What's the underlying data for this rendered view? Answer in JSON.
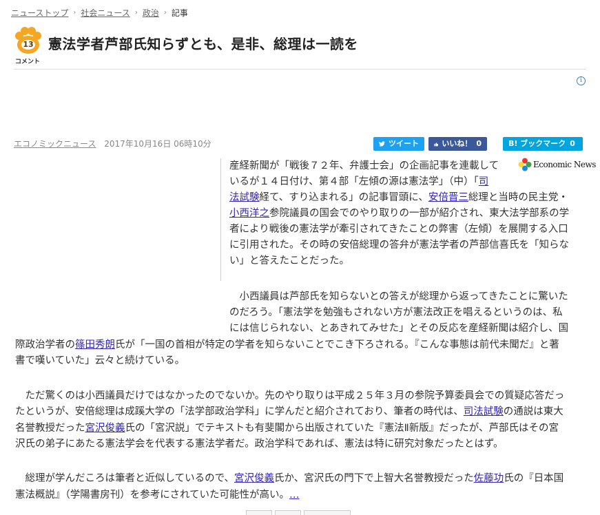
{
  "breadcrumb": {
    "items": [
      "ニューストップ",
      "社会ニュース",
      "政治"
    ],
    "current": "記事"
  },
  "article": {
    "comment_count": "13",
    "comment_label": "コメント",
    "title": "憲法学者芦部氏知らずとも、是非、総理は一読を",
    "source": "エコノミックニュース",
    "datetime": "2017年10月16日 06時10分",
    "publisher_logo": "Economic News"
  },
  "share": {
    "tweet_label": "ツイート",
    "like_label": "いいね！",
    "like_count": "0",
    "bookmark_label": "B! ブックマーク",
    "bookmark_count": "0"
  },
  "body": {
    "p1": [
      [
        "産経新聞が「戦後７２年、弁護士会」の企画記事を連載して"
      ],
      [
        "いるが１４日付け、第４部「左傾の源は憲法学」（中）「",
        {
          "link": "司"
        }
      ],
      [
        {
          "link": "法試験"
        },
        "経て、すり込まれる」の記事冒頭に、",
        {
          "link": "安倍晋三"
        },
        "総理と当時の民主党・"
      ],
      [
        {
          "link": "小西洋之"
        },
        "参院議員の国会でのやり取りの一部が紹介され、東大法学部系の学"
      ],
      [
        "者により戦後の憲法学が牽引されてきたことの弊害（左傾）を展開する入口"
      ],
      [
        "に引用された。その時の安倍総理の答弁が憲法学者の芦部信喜氏を「知らな"
      ],
      [
        "い」と答えたことだった。"
      ]
    ],
    "p2": [
      [
        "　小西議員は芦部氏を知らないとの答えが総理から返ってきたことに驚いた"
      ],
      [
        "のだろう。「憲法学を勉強もされない方が憲法改正を唱えるというのは、私"
      ],
      [
        "には信じられない、とあきれてみせた」とその反応を産経新聞は紹介し、国"
      ],
      [
        "際政治学者の",
        {
          "link": "篠田秀朗"
        },
        "氏が「一国の首相が特定の学者を知らないことでこき下ろされる。『こんな事態は前代未聞だ』と著"
      ],
      [
        "書で嘆いていた」云々と続けている。"
      ]
    ],
    "p3": [
      [
        "　ただ驚くのは小西議員だけではなかったのでないか。先のやり取りは平成２５年３月の参院予算委員会での質疑応答だっ"
      ],
      [
        "たというが、安倍総理は成蹊大学の「法学部政治学科」に学んだと紹介されており、筆者の時代は、",
        {
          "link": "司法試験"
        },
        "の通説は東大"
      ],
      [
        "名誉教授だった",
        {
          "link": "宮沢俊義"
        },
        "氏の「宮沢説」でテキストも有斐閣から出版されていた『憲法Ⅱ新版』だったが、芦部氏はその宮"
      ],
      [
        "沢氏の弟子にあたる憲法学会を代表する憲法学者だ。政治学科であれば、憲法は特に研究対象だったとはず。"
      ]
    ],
    "p4": [
      [
        "　総理が学んだころは筆者と近似しているので、",
        {
          "link": "宮沢俊義"
        },
        "氏か、宮沢氏の門下で上智大名誉教授だった",
        {
          "link": "佐藤功"
        },
        "氏の『日本国"
      ],
      [
        "憲法概説』（学陽書房刊）を参考にされていた可能性が高い。",
        {
          "link": "…"
        }
      ]
    ]
  },
  "icons": {
    "paw": "paw-icon",
    "info": "info-icon",
    "twitter": "twitter-bird-icon",
    "like": "thumbs-up-icon"
  },
  "colors": {
    "tweet": "#1da1f2",
    "like": "#3b5998",
    "hatena": "#00a4de",
    "paw": "#f5a623",
    "link": "#3325b8"
  }
}
